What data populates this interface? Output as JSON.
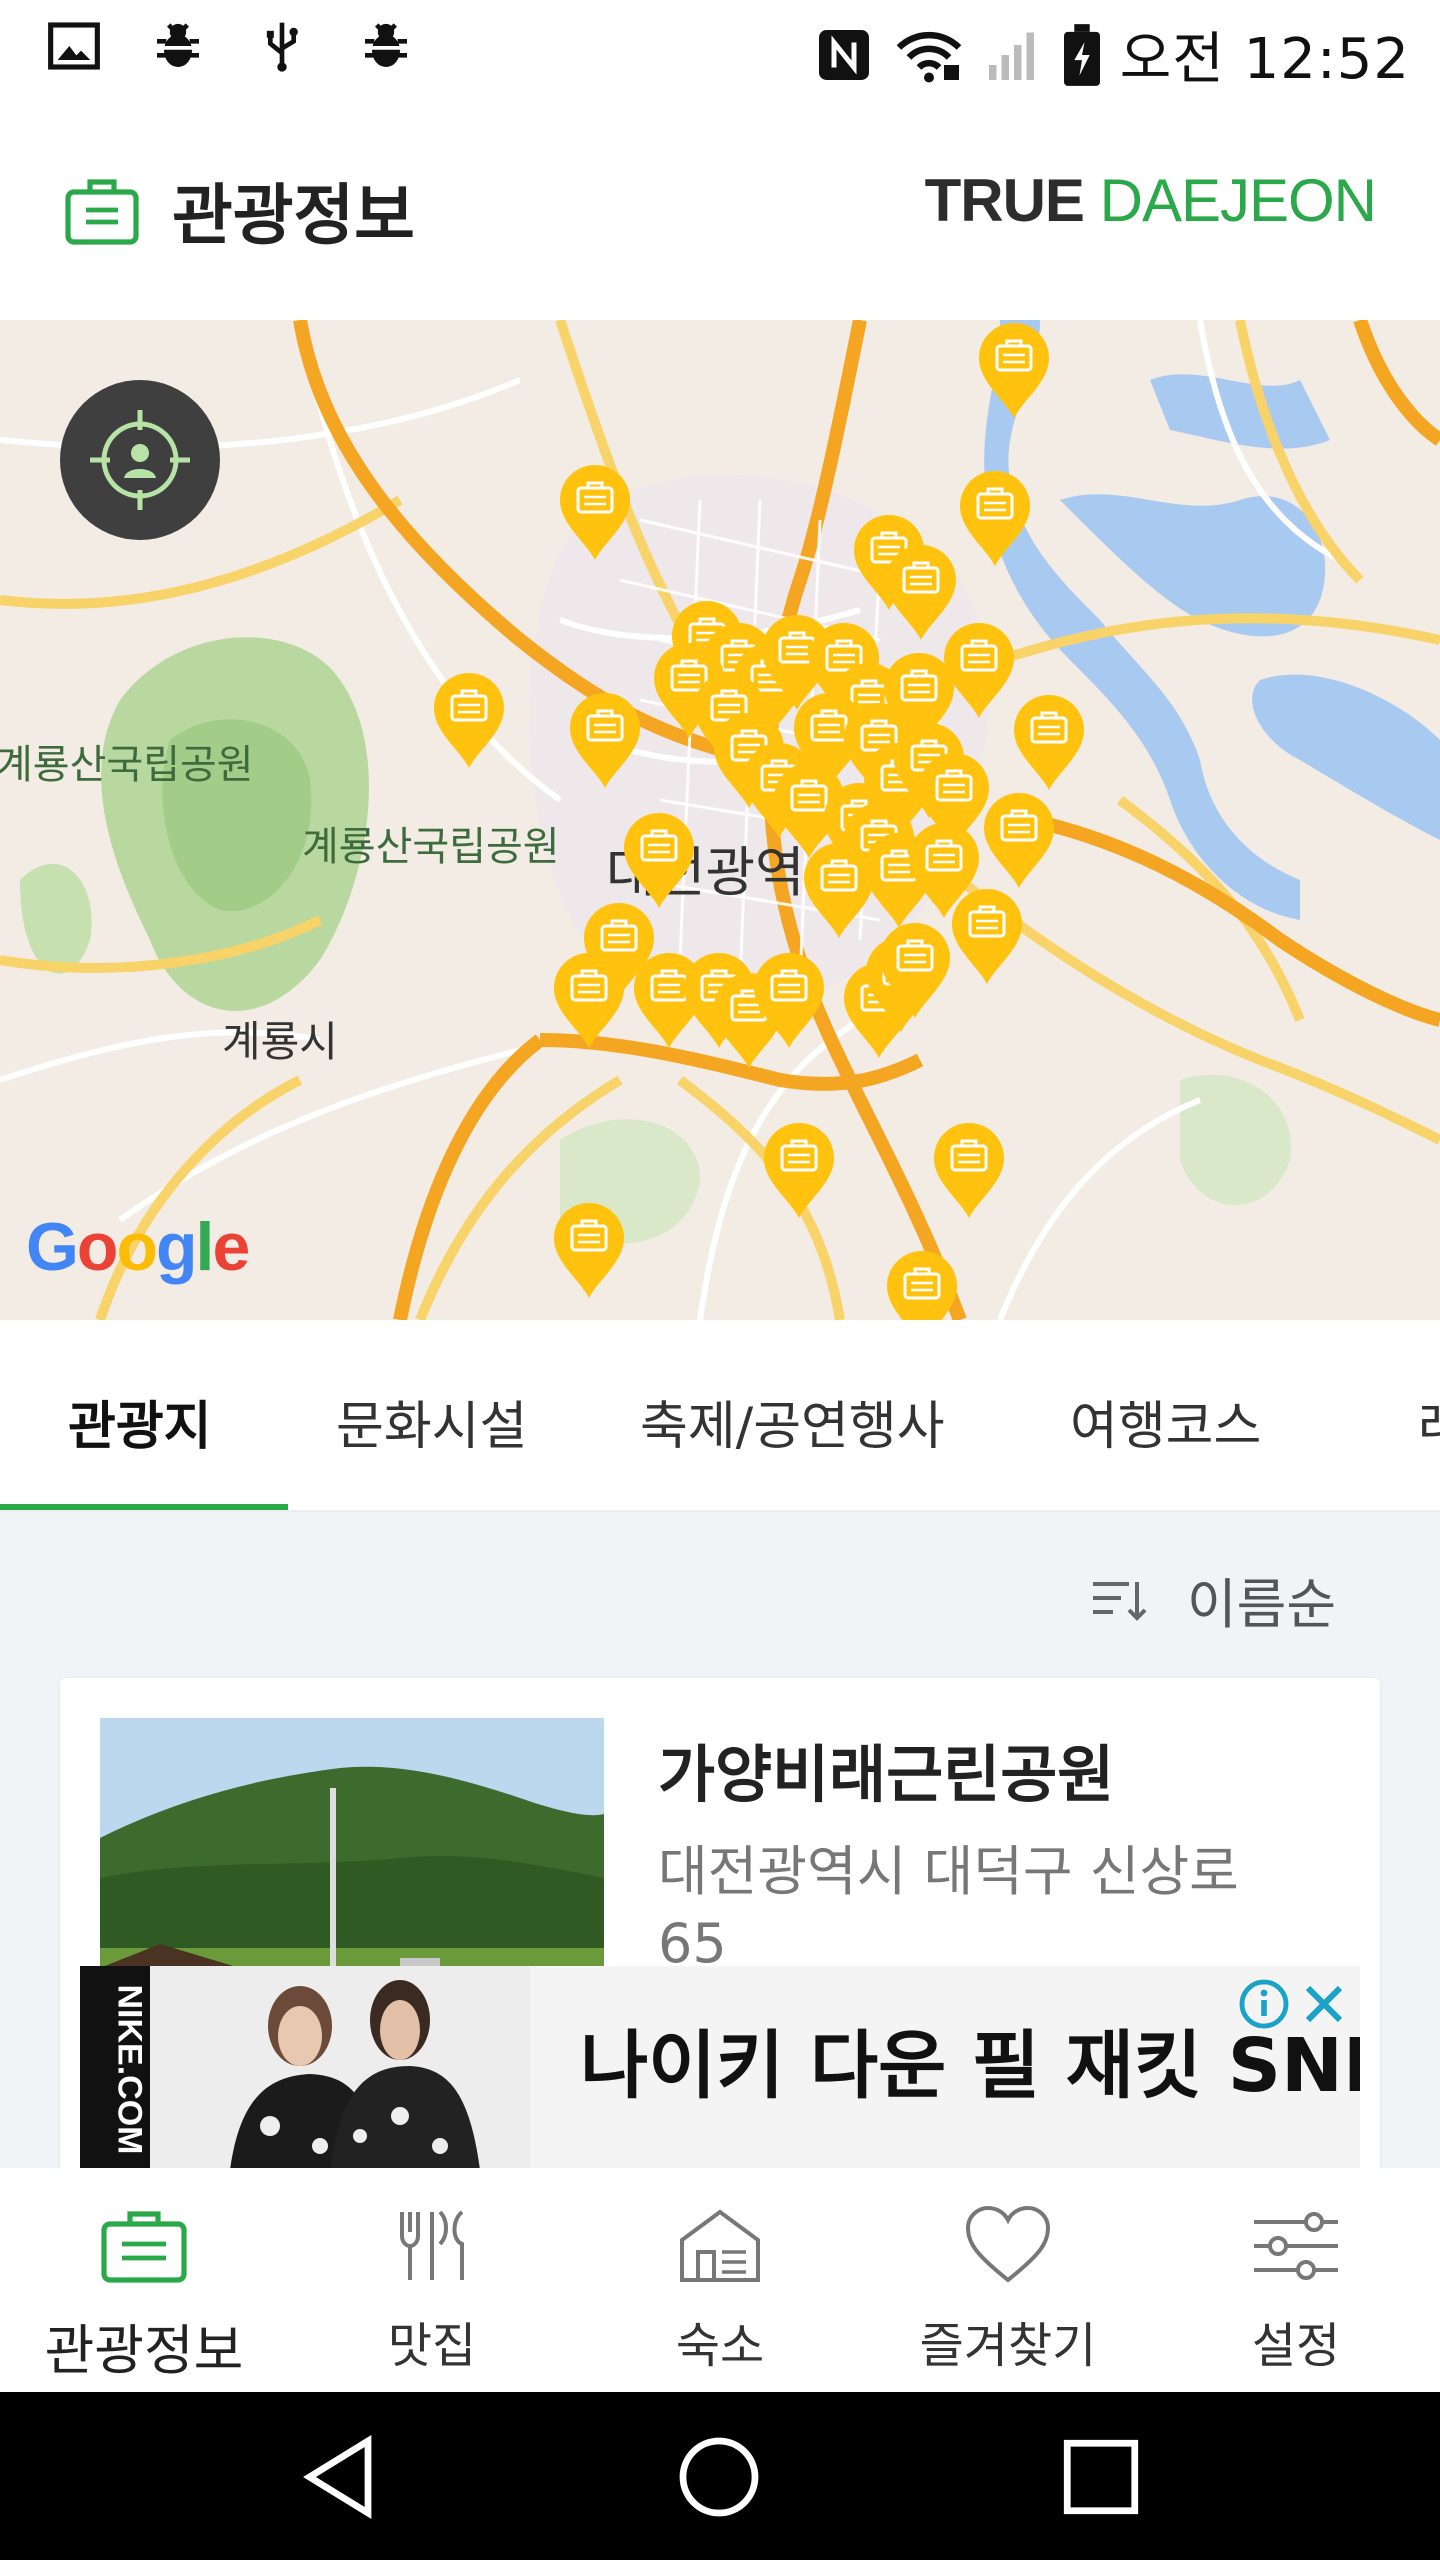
{
  "status_bar": {
    "time": "오전 12:52",
    "left_icons": [
      "image-icon",
      "bug-icon",
      "usb-icon",
      "bug-icon"
    ],
    "right_icons": [
      "nfc-icon",
      "wifi-icon",
      "signal-icon",
      "battery-icon"
    ]
  },
  "header": {
    "title": "관광정보",
    "icon": "briefcase-icon",
    "brand_part1": "TRUE",
    "brand_part2": "DAEJEON"
  },
  "map": {
    "labels": {
      "park1": "계룡산국립공원",
      "park2": "계룡산국립공원",
      "city_center": "대전광역시",
      "gyeryong": "계룡시"
    },
    "google": "Google",
    "pin_icon": "briefcase-icon",
    "pin_color": "#ffc20e"
  },
  "tabs": [
    {
      "label": "관광지",
      "active": true
    },
    {
      "label": "문화시설",
      "active": false
    },
    {
      "label": "축제/공연행사",
      "active": false
    },
    {
      "label": "여행코스",
      "active": false
    },
    {
      "label": "레",
      "active": false
    }
  ],
  "sort": {
    "label": "이름순",
    "icon": "sort-icon"
  },
  "list": [
    {
      "title": "가양비래근린공원",
      "address": "대전광역시 대덕구 신상로 65"
    }
  ],
  "ad": {
    "brand": "NIKE.COM",
    "text": "나이키 다운 필 재킷 SNL"
  },
  "bottom_nav": [
    {
      "label": "관광정보",
      "icon": "briefcase-icon",
      "active": true
    },
    {
      "label": "맛집",
      "icon": "utensils-icon",
      "active": false
    },
    {
      "label": "숙소",
      "icon": "house-icon",
      "active": false
    },
    {
      "label": "즐겨찾기",
      "icon": "heart-icon",
      "active": false
    },
    {
      "label": "설정",
      "icon": "sliders-icon",
      "active": false
    }
  ],
  "colors": {
    "accent": "#2aa84a",
    "pin": "#ffc20e",
    "ad_info": "#19a3c8"
  }
}
